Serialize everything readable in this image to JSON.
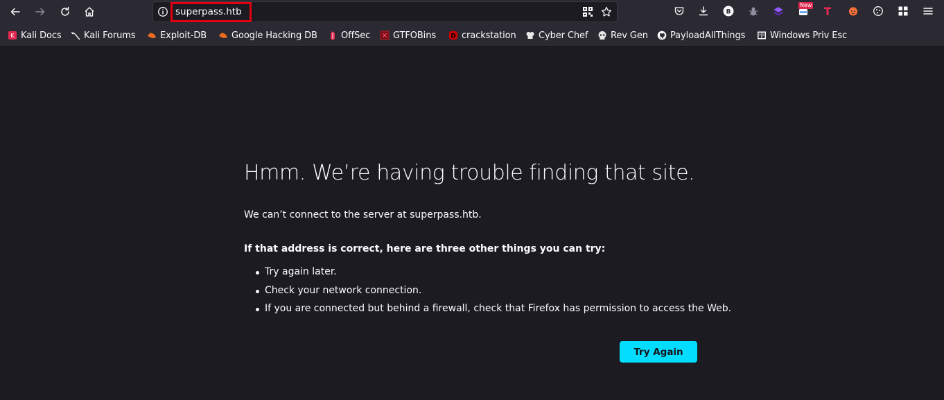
{
  "urlbar": {
    "url": "superpass.htb"
  },
  "toolbar": {
    "new_badge": "New"
  },
  "bookmarks": [
    {
      "label": "Kali Docs",
      "icon": "kali-docs-icon"
    },
    {
      "label": "Kali Forums",
      "icon": "kali-forums-icon"
    },
    {
      "label": "Exploit-DB",
      "icon": "exploit-db-icon"
    },
    {
      "label": "Google Hacking DB",
      "icon": "ghdb-icon"
    },
    {
      "label": "OffSec",
      "icon": "offsec-icon"
    },
    {
      "label": "GTFOBins",
      "icon": "gtfobins-icon"
    },
    {
      "label": "crackstation",
      "icon": "crackstation-icon"
    },
    {
      "label": "Cyber Chef",
      "icon": "cyberchef-icon"
    },
    {
      "label": "Rev Gen",
      "icon": "skull-icon"
    },
    {
      "label": "PayloadAllThings",
      "icon": "github-icon"
    },
    {
      "label": "Windows Priv Esc",
      "icon": "book-icon"
    }
  ],
  "error": {
    "title": "Hmm. We’re having trouble finding that site.",
    "description": "We can’t connect to the server at superpass.htb.",
    "subtitle": "If that address is correct, here are three other things you can try:",
    "tips": [
      "Try again later.",
      "Check your network connection.",
      "If you are connected but behind a firewall, check that Firefox has permission to access the Web."
    ],
    "button": "Try Again"
  },
  "colors": {
    "accent": "#00ddff",
    "page_bg": "#1c1b22",
    "chrome_bg": "#2b2a33",
    "highlight": "#e0000f"
  }
}
